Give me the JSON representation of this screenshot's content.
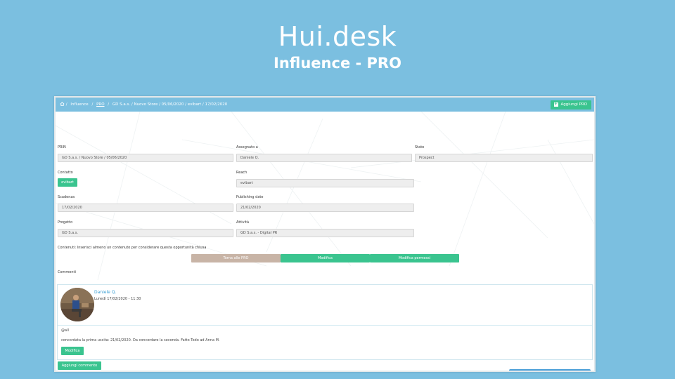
{
  "hero": {
    "title": "Hui.desk",
    "subtitle": "Influence - PRO"
  },
  "breadcrumb": {
    "sep": "/",
    "items": [
      "Influence",
      "PRO",
      "GD S.a.s. / Nuovo Store / 05/06/2020 / evibart / 17/02/2020"
    ]
  },
  "header_button": {
    "label": "Aggiungi PRO"
  },
  "fields": {
    "prin": {
      "label": "PRIN",
      "value": "GD S.a.s. / Nuovo Store / 05/06/2020"
    },
    "assegnato": {
      "label": "Assegnato a",
      "value": "Daniele Q."
    },
    "stato": {
      "label": "Stato",
      "value": "Prospect"
    },
    "contatto": {
      "label": "Contatto",
      "value": "evibart"
    },
    "reach": {
      "label": "Reach",
      "value": "evibart"
    },
    "scadenza": {
      "label": "Scadenza",
      "value": "17/02/2020"
    },
    "publishing": {
      "label": "Publishing date",
      "value": "21/02/2020"
    },
    "progetto": {
      "label": "Progetto",
      "value": "GD S.a.s."
    },
    "attivita": {
      "label": "Attività",
      "value": "GD S.a.s. - Digital PR"
    }
  },
  "contenuti_text": "Contenuti: Inserisci almeno un contenuto per considerare questa opportunità chiusa",
  "actions": {
    "back": "Torna alle PRO",
    "modifica": "Modifica",
    "permessi": "Modifica permessi"
  },
  "commenti_label": "Commenti",
  "comment": {
    "author": "Daniele Q.",
    "time": "Lunedì 17/02/2020 - 11:30",
    "mention": "@all",
    "body": "concordata la prima uscita: 21/02/2020. Da concordare la seconda. Fatto Todo ad Anna M.",
    "edit_label": "Modifica"
  },
  "add_comment_label": "Aggiungi commento",
  "colors": {
    "background": "#7bbfe0",
    "green": "#3ac48f",
    "beige": "#c8b4a6",
    "link": "#3a9fd4"
  },
  "icons": [
    "home-icon",
    "plus-icon"
  ]
}
